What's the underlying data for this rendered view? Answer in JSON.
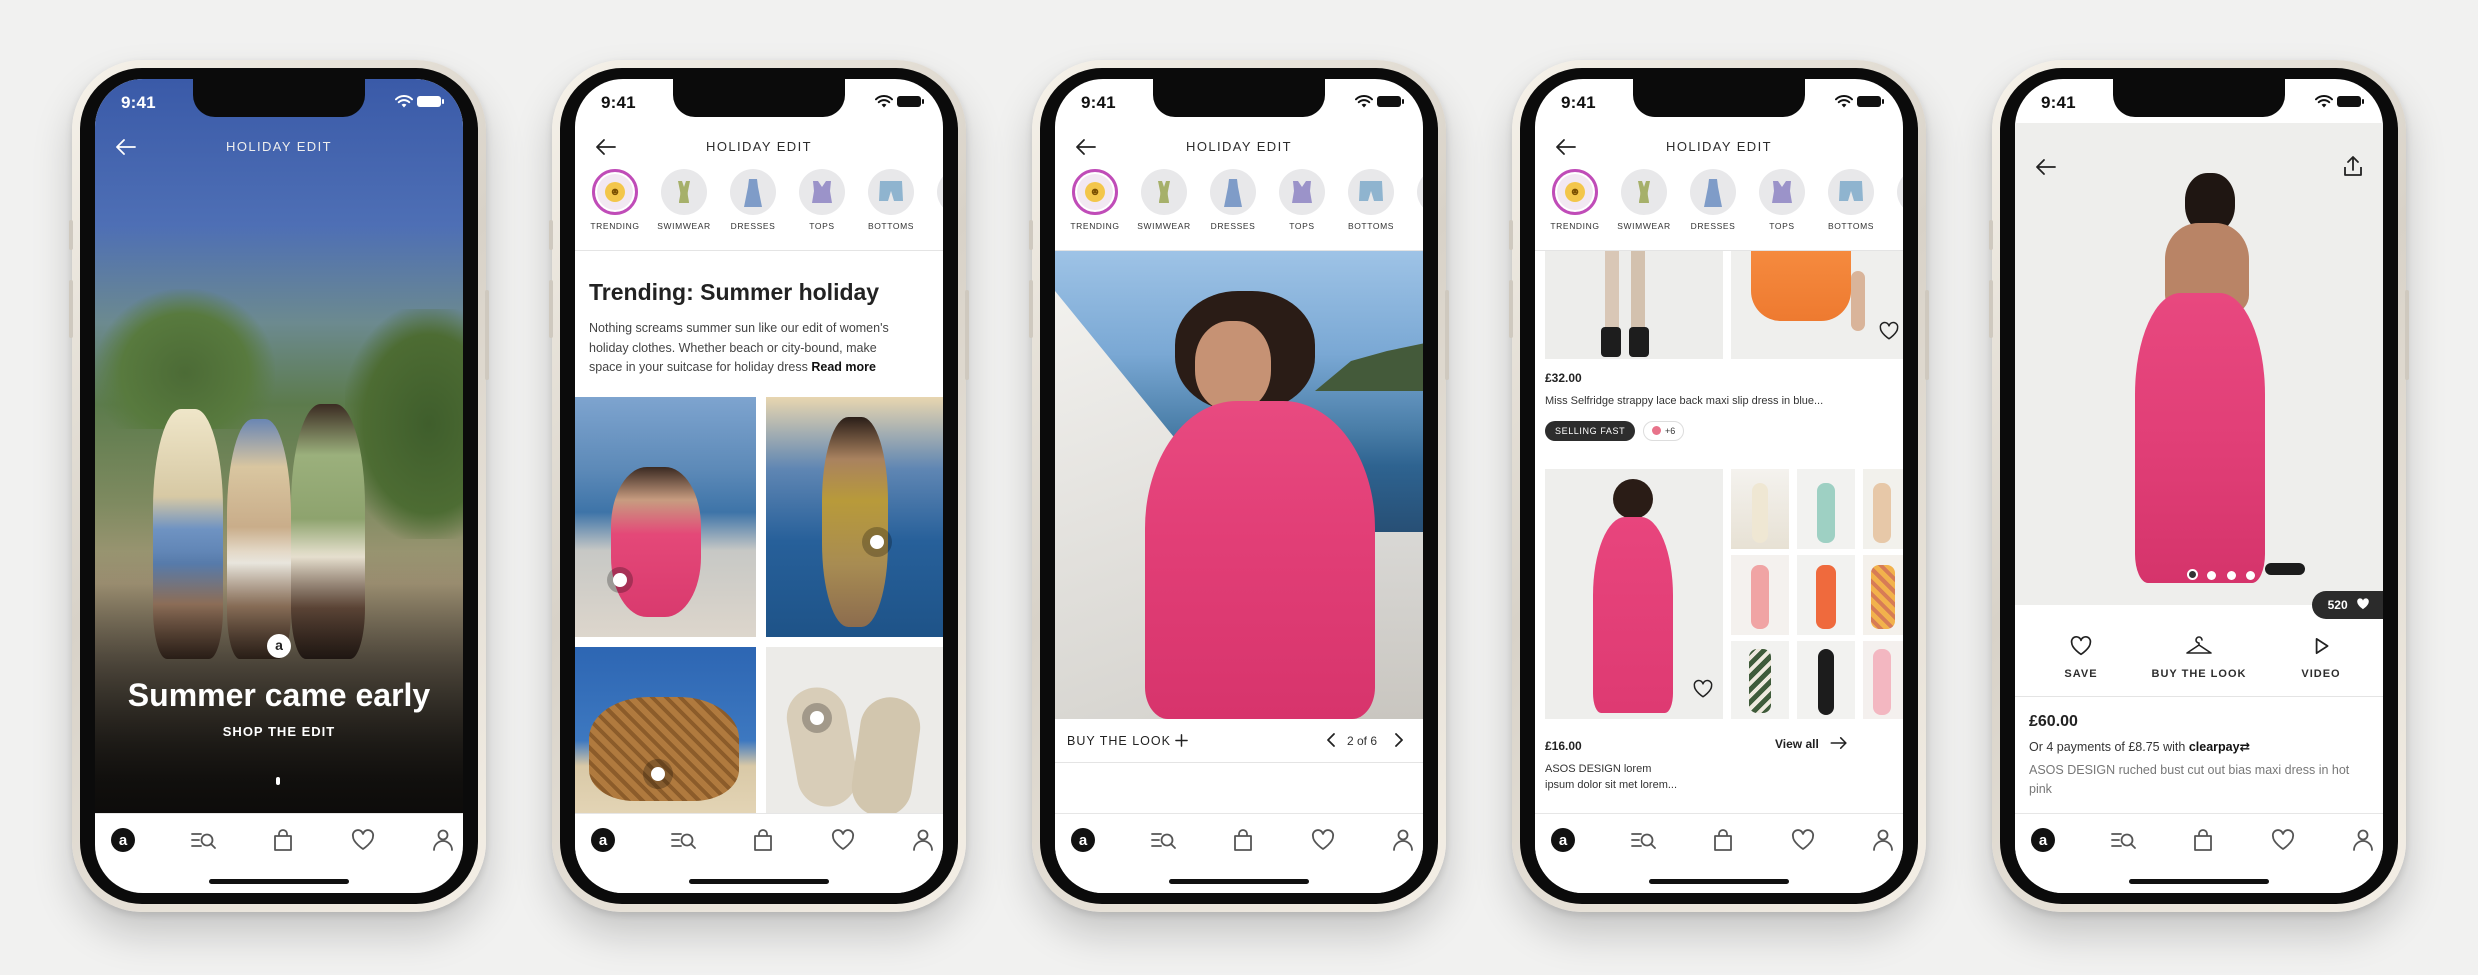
{
  "status": {
    "time": "9:41"
  },
  "header": {
    "title": "HOLIDAY EDIT"
  },
  "categories": [
    {
      "label": "TRENDING"
    },
    {
      "label": "SWIMWEAR"
    },
    {
      "label": "DRESSES"
    },
    {
      "label": "TOPS"
    },
    {
      "label": "BOTTOMS"
    }
  ],
  "screen1": {
    "headline": "Summer came early",
    "cta": "SHOP THE EDIT",
    "logo_glyph": "a"
  },
  "screen2": {
    "heading": "Trending: Summer holiday",
    "body_line1": "Nothing screams summer sun like our edit of women's",
    "body_line2": "holiday clothes. Whether beach or city-bound, make",
    "body_line3": "space in your suitcase for holiday dress",
    "read_more": "Read more"
  },
  "screen3": {
    "buy_the_look": "BUY THE LOOK",
    "pager": "2 of 6"
  },
  "screen4": {
    "product1": {
      "price": "£32.00",
      "name": "Miss Selfridge strappy lace back maxi slip dress in blue...",
      "badge": "SELLING FAST",
      "swatches": "+6"
    },
    "product2": {
      "price": "£16.00",
      "name_line1": "ASOS DESIGN lorem",
      "name_line2": "ipsum dolor sit met lorem...",
      "view_all": "View all"
    }
  },
  "screen5": {
    "likes": "520",
    "actions": {
      "save": "SAVE",
      "buy": "BUY THE LOOK",
      "video": "VIDEO"
    },
    "price": "£60.00",
    "installments": "Or 4 payments of £8.75 with",
    "clearpay": "clearpay",
    "name": "ASOS DESIGN ruched bust cut out bias maxi dress in hot pink"
  },
  "colors": {
    "accent_pink": "#e8417f",
    "trending_ring": "#c04cb8",
    "badge_dark": "#2d2d2d"
  },
  "icons": [
    "back-arrow-icon",
    "wifi-icon",
    "battery-icon",
    "asos-home-icon",
    "search-list-icon",
    "bag-icon",
    "heart-icon",
    "profile-icon",
    "share-icon",
    "hanger-icon",
    "play-icon",
    "plus-icon",
    "chevron-left-icon",
    "chevron-right-icon",
    "arrow-right-icon"
  ]
}
